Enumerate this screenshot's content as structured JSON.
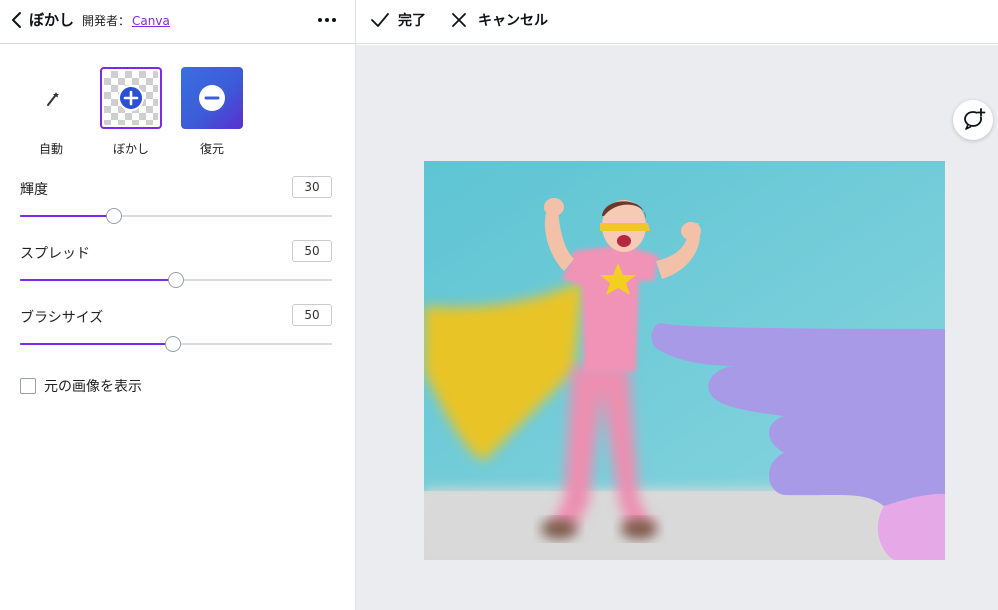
{
  "panel": {
    "title": "ぼかし",
    "developer_prefix": "開発者：",
    "developer_name": "Canva"
  },
  "modes": [
    {
      "label": "自動",
      "icon": "magic-wand-icon"
    },
    {
      "label": "ぼかし",
      "icon": "plus-circle-icon",
      "selected": true
    },
    {
      "label": "復元",
      "icon": "minus-circle-icon"
    }
  ],
  "sliders": {
    "intensity": {
      "label": "輝度",
      "value": "30",
      "fraction": 0.3
    },
    "spread": {
      "label": "スプレッド",
      "value": "50",
      "fraction": 0.5
    },
    "brush_size": {
      "label": "ブラシサイズ",
      "value": "50",
      "fraction": 0.49
    }
  },
  "show_original": {
    "label": "元の画像を表示",
    "checked": false
  },
  "toolbar": {
    "done_label": "完了",
    "cancel_label": "キャンセル"
  },
  "colors": {
    "accent": "#7d2ae8",
    "brush_overlay": "#a99ae8"
  }
}
